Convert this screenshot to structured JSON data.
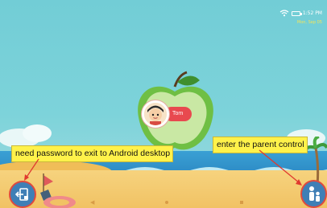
{
  "status_bar": {
    "time": "1:52 PM",
    "date": "Mon, Sep 05",
    "icons": [
      "wifi-icon",
      "battery-icon"
    ]
  },
  "profile": {
    "name": "Tom",
    "avatar_icon": "child-avatar-icon"
  },
  "annotations": {
    "exit_note": "need password to exit to Android desktop",
    "parent_note": "enter the parent control"
  },
  "buttons": {
    "exit_icon": "exit-door-icon",
    "parent_icon": "parent-child-icon"
  },
  "navigation": {
    "icons": [
      "back-icon",
      "home-icon",
      "recents-icon"
    ]
  },
  "colors": {
    "sky": "#72cdd6",
    "sea": "#2f8ec7",
    "sand": "#f1c264",
    "apple": "#6fbf44",
    "name_pill": "#e8494f",
    "callout": "#fff24a",
    "highlight": "#e0392f",
    "button": "#3f7fb6"
  }
}
